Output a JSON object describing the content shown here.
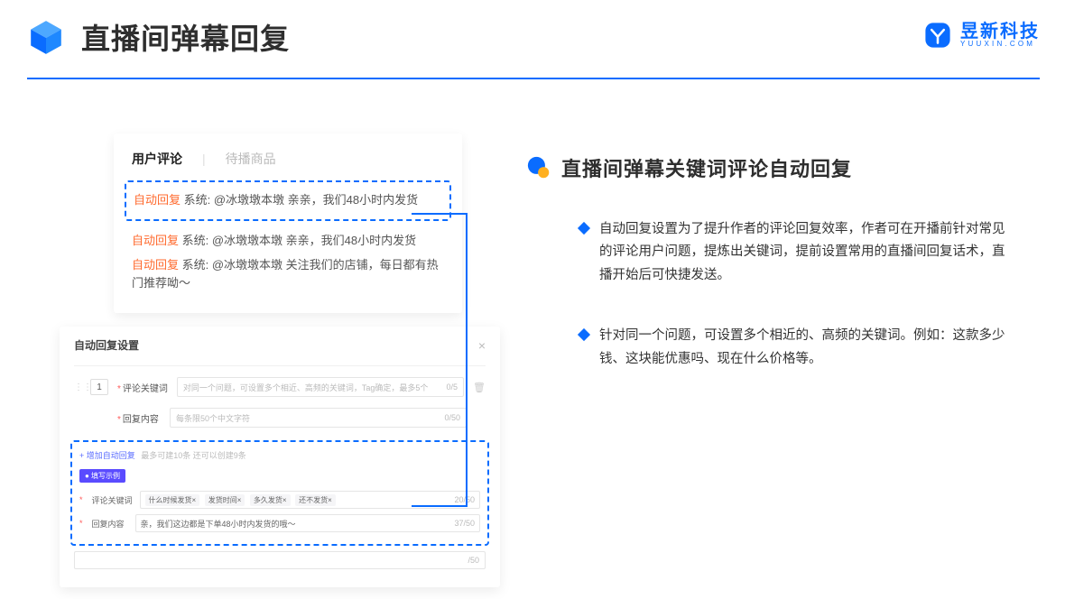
{
  "header": {
    "title": "直播间弹幕回复",
    "brand_cn": "昱新科技",
    "brand_en": "YUUXIN.COM"
  },
  "comments": {
    "tabs": {
      "active": "用户评论",
      "other": "待播商品",
      "sep": "|"
    },
    "highlighted": {
      "tag": "自动回复",
      "text": "系统: @冰墩墩本墩 亲亲，我们48小时内发货"
    },
    "line2": {
      "tag": "自动回复",
      "text": "系统: @冰墩墩本墩 亲亲，我们48小时内发货"
    },
    "line3": {
      "tag": "自动回复",
      "text": "系统: @冰墩墩本墩 关注我们的店铺，每日都有热门推荐呦～"
    }
  },
  "settings": {
    "title": "自动回复设置",
    "close": "×",
    "index": "1",
    "keyword_label": "评论关键词",
    "keyword_placeholder": "对同一个问题，可设置多个相近、高频的关键词，Tag确定，最多5个",
    "keyword_counter": "0/5",
    "content_label": "回复内容",
    "content_placeholder": "每条限50个中文字符",
    "content_counter": "0/50",
    "add_link": "+ 增加自动回复",
    "add_hint": "最多可建10条 还可以创建9条",
    "example_tag": "● 填写示例",
    "ex_keyword_label": "评论关键词",
    "ex_chips": [
      "什么时候发货×",
      "发货时间×",
      "多久发货×",
      "还不发货×"
    ],
    "ex_keyword_counter": "20/50",
    "ex_content_label": "回复内容",
    "ex_content_text": "亲，我们这边都是下单48小时内发货的哦～",
    "ex_content_counter": "37/50",
    "outside_counter": "/50",
    "trash": "🗑"
  },
  "right": {
    "section_title": "直播间弹幕关键词评论自动回复",
    "bullet1": "自动回复设置为了提升作者的评论回复效率，作者可在开播前针对常见的评论用户问题，提炼出关键词，提前设置常用的直播间回复话术，直播开始后可快捷发送。",
    "bullet2": "针对同一个问题，可设置多个相近的、高频的关键词。例如：这款多少钱、这块能优惠吗、现在什么价格等。"
  }
}
